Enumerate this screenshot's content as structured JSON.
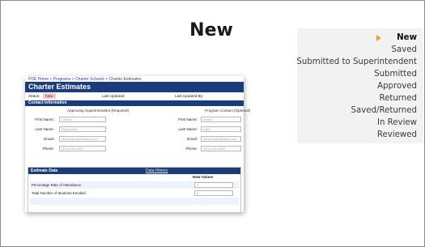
{
  "slide": {
    "title": "New"
  },
  "status_list": {
    "items": [
      "New",
      "Saved",
      "Submitted to Superintendent",
      "Submitted",
      "Approved",
      "Returned",
      "Saved/Returned",
      "In Review",
      "Reviewed"
    ],
    "active_index": 0,
    "arrow_color": "#f0a030"
  },
  "app": {
    "breadcrumb": {
      "link": "PDE Home > Programs > Charter Schools >",
      "current": "Charter Estimates"
    },
    "header": "Charter Estimates",
    "status": {
      "status_label": "Status:",
      "status_value": "New",
      "last_updated_label": "Last Updated:",
      "last_updated_by_label": "Last Updated By:"
    },
    "contact": {
      "section_title": "Contact Information",
      "left_heading": "Approving Superintendent (Required)",
      "right_heading": "Program Contact (Optional)",
      "labels": {
        "first_name": "First Name:",
        "last_name": "Last Name:",
        "email": "Email:",
        "phone": "Phone:"
      },
      "left_values": {
        "first_name": "Charlie",
        "last_name": "Superinten",
        "email": "charlie@superintend.com",
        "phone": "(111) 222-3333"
      },
      "right_values": {
        "first_name": "Admin",
        "last_name": "User",
        "email": "admin.user@state.com",
        "phone": "(111) 222-3333"
      }
    },
    "estimate": {
      "section_title": "Estimate Data",
      "history_link": "Data History",
      "column_header": "New Values",
      "rows": [
        {
          "label": "Percentage Rate of Attendance",
          "value": "0"
        },
        {
          "label": "Total Number of Students Enrolled",
          "value": "0"
        }
      ]
    }
  },
  "colors": {
    "header_blue": "#1c3b7a",
    "status_highlight": "#f6c9c9",
    "panel_gray": "#f2f2f2"
  }
}
